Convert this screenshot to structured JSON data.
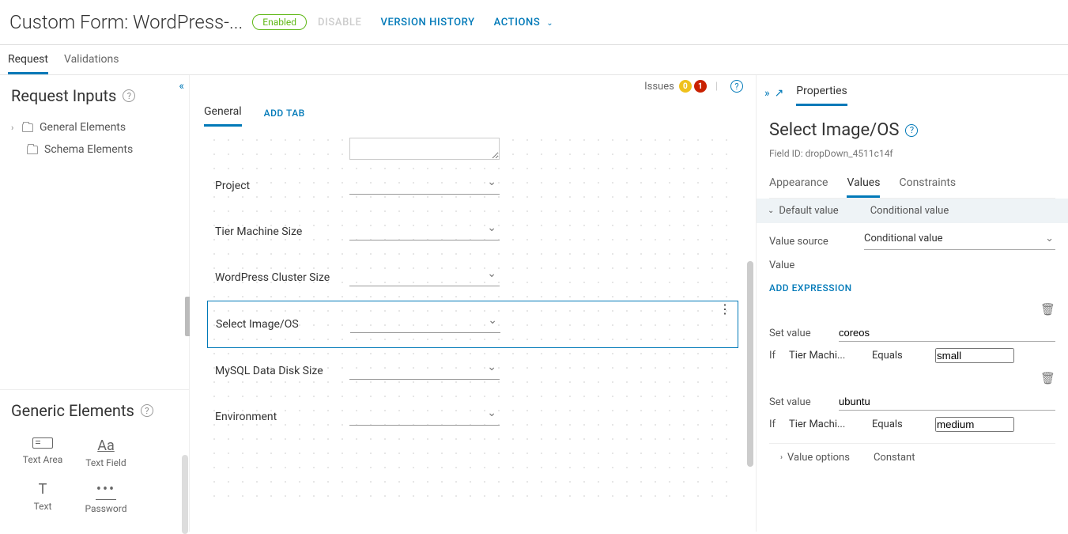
{
  "header": {
    "title": "Custom Form: WordPress-...",
    "status": "Enabled",
    "disable": "DISABLE",
    "version": "VERSION HISTORY",
    "actions": "ACTIONS"
  },
  "subtabs": {
    "request": "Request",
    "validations": "Validations"
  },
  "left": {
    "request_inputs": "Request Inputs",
    "general_elements": "General Elements",
    "schema_elements": "Schema Elements",
    "generic_elements": "Generic Elements",
    "items": {
      "textarea": "Text Area",
      "textfield": "Text Field",
      "text": "Text",
      "password": "Password"
    }
  },
  "designer": {
    "issues_label": "Issues",
    "issues_warn": "0",
    "issues_err": "1",
    "tab_general": "General",
    "add_tab": "ADD TAB",
    "fields": {
      "project": "Project",
      "tier_size": "Tier Machine Size",
      "wp_cluster": "WordPress Cluster Size",
      "select_image": "Select Image/OS",
      "mysql_disk": "MySQL Data Disk Size",
      "environment": "Environment"
    }
  },
  "props": {
    "panel": "Properties",
    "title": "Select Image/OS",
    "field_id_label": "Field ID: ",
    "field_id": "dropDown_4511c14f",
    "subtabs": {
      "appearance": "Appearance",
      "values": "Values",
      "constraints": "Constraints"
    },
    "acc": {
      "default": "Default value",
      "conditional": "Conditional value"
    },
    "value_source_label": "Value source",
    "value_source": "Conditional value",
    "value_label": "Value",
    "add_expression": "ADD EXPRESSION",
    "set_value_label": "Set value",
    "if_label": "If",
    "equals": "Equals",
    "tier_field": "Tier Machi...",
    "expr1": {
      "setvalue": "coreos",
      "val": "small"
    },
    "expr2": {
      "setvalue": "ubuntu",
      "val": "medium"
    },
    "value_options": "Value options",
    "constant": "Constant"
  }
}
